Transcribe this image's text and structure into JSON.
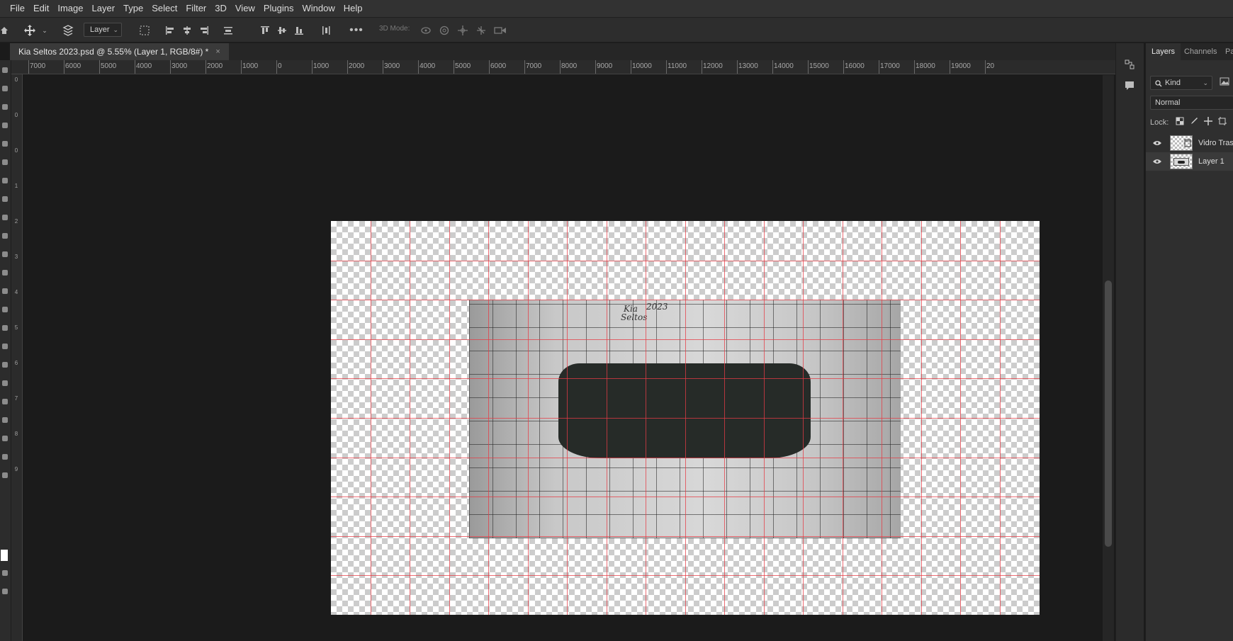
{
  "menu": [
    "File",
    "Edit",
    "Image",
    "Layer",
    "Type",
    "Select",
    "Filter",
    "3D",
    "View",
    "Plugins",
    "Window",
    "Help"
  ],
  "options_bar": {
    "auto_select_target": "Layer",
    "mode_3d_label": "3D Mode:",
    "icons": [
      "move-tool-icon",
      "auto-select-icon",
      "transform-controls-icon",
      "align-left-icon",
      "align-center-icon",
      "align-right-icon",
      "distribute-icon",
      "align-top-icon",
      "align-middle-icon",
      "align-bottom-icon",
      "distribute-vertical-icon",
      "more-icon",
      "orbit-3d-icon",
      "roll-3d-icon",
      "drag-3d-icon",
      "slide-3d-icon",
      "scale-3d-icon"
    ]
  },
  "document_tab": {
    "title": "Kia Seltos 2023.psd @ 5.55% (Layer 1, RGB/8#) *",
    "close": "×"
  },
  "ruler_top_labels": [
    "7000",
    "6000",
    "5000",
    "4000",
    "3000",
    "2000",
    "1000",
    "0",
    "1000",
    "2000",
    "3000",
    "4000",
    "5000",
    "6000",
    "7000",
    "8000",
    "9000",
    "10000",
    "11000",
    "12000",
    "13000",
    "14000",
    "15000",
    "16000",
    "17000",
    "18000",
    "19000",
    "20"
  ],
  "ruler_left_labels": [
    "0",
    "0",
    "0",
    "1",
    "2",
    "3",
    "4",
    "5",
    "6",
    "7",
    "8",
    "9"
  ],
  "canvas": {
    "photo_notes": [
      "Kia",
      "Seltos",
      "2023"
    ]
  },
  "layers_panel": {
    "tabs": [
      "Layers",
      "Channels",
      "Pa"
    ],
    "filter_kind": "Kind",
    "blend_mode": "Normal",
    "lock_label": "Lock:",
    "layers": [
      {
        "name": "Vidro Trase",
        "visible": true,
        "selected": false
      },
      {
        "name": "Layer 1",
        "visible": true,
        "selected": true
      }
    ]
  },
  "colors": {
    "guide": "#e63c46",
    "menubar": "#323232",
    "panel": "#2f2f2f"
  }
}
